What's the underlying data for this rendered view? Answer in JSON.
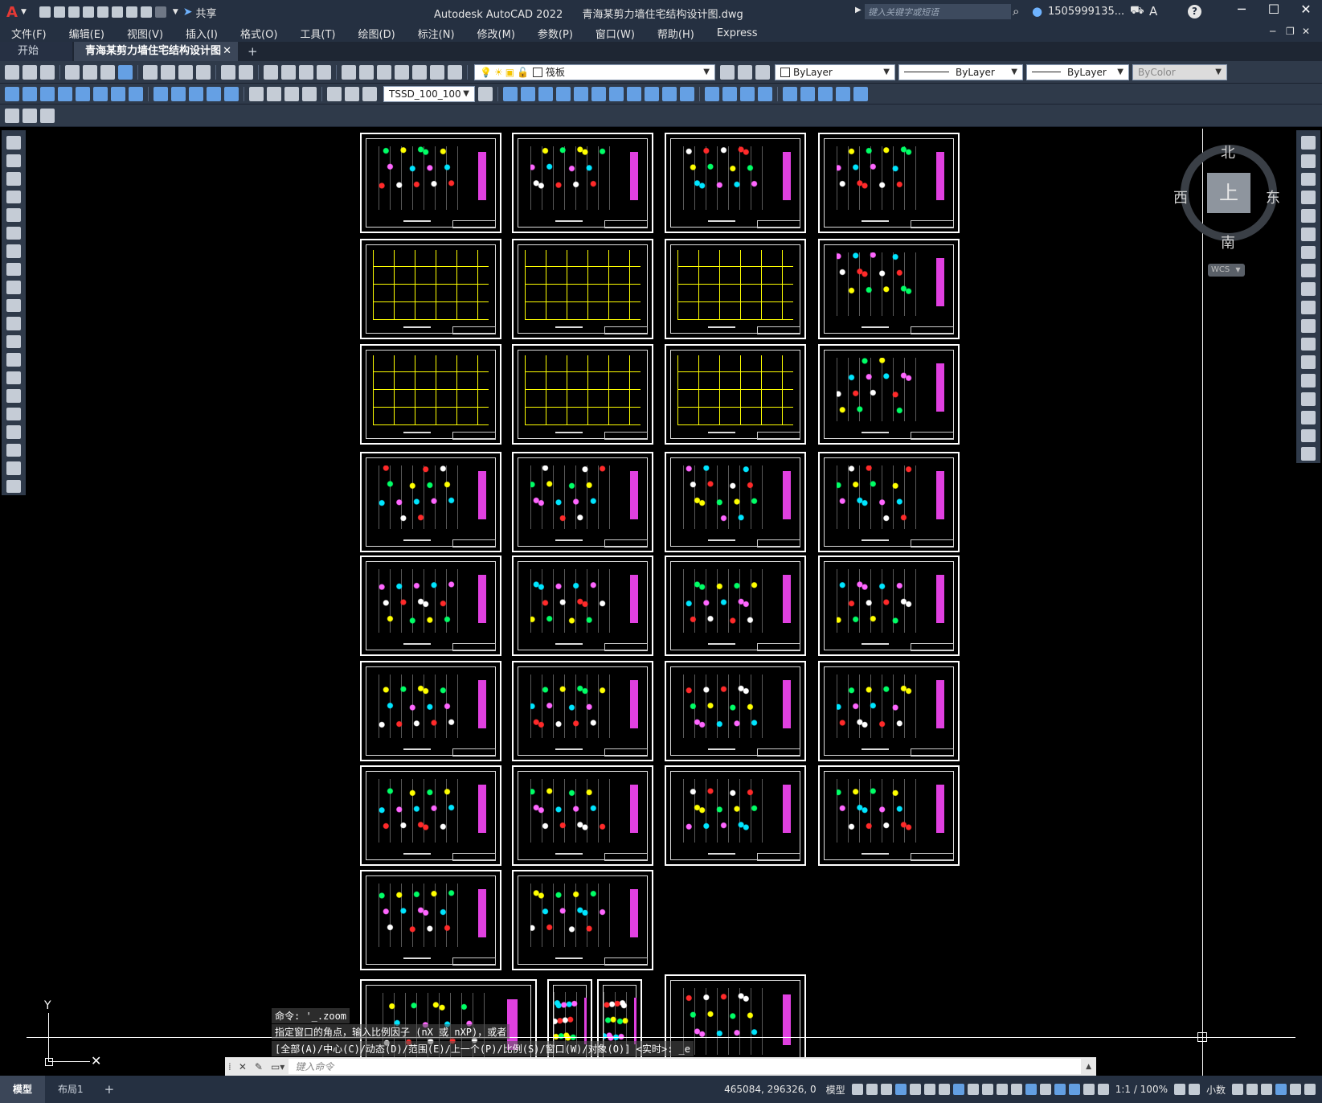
{
  "app": {
    "title": "Autodesk AutoCAD 2022",
    "document": "青海某剪力墙住宅结构设计图.dwg",
    "share_label": "共享",
    "search_placeholder": "键入关键字或短语",
    "user": "1505999135...",
    "help_icon": "?"
  },
  "menu": [
    "文件(F)",
    "编辑(E)",
    "视图(V)",
    "插入(I)",
    "格式(O)",
    "工具(T)",
    "绘图(D)",
    "标注(N)",
    "修改(M)",
    "参数(P)",
    "窗口(W)",
    "帮助(H)",
    "Express"
  ],
  "tabs": [
    {
      "label": "开始",
      "active": false
    },
    {
      "label": "青海某剪力墙住宅结构设计图*",
      "active": true
    }
  ],
  "toolbar": {
    "layer_name": "筏板",
    "color": "ByLayer",
    "linetype": "ByLayer",
    "lineweight": "ByLayer",
    "plotstyle": "ByColor",
    "dimstyle": "TSSD_100_100"
  },
  "viewcube": {
    "north": "北",
    "south": "南",
    "east": "东",
    "west": "西",
    "top": "上",
    "wcs": "WCS"
  },
  "ucs": {
    "y_label": "Y"
  },
  "command": {
    "history": [
      "命令: '_.zoom",
      "指定窗口的角点，输入比例因子 (nX 或 nXP)，或者",
      "[全部(A)/中心(C)/动态(D)/范围(E)/上一个(P)/比例(S)/窗口(W)/对象(O)] <实时>: _e"
    ],
    "input_placeholder": "键入命令"
  },
  "status": {
    "layout_tabs": [
      "模型",
      "布局1"
    ],
    "add_tab": "+",
    "coords": "465084, 296326, 0",
    "space": "模型",
    "scale": "1:1 / 100%",
    "units": "小数"
  },
  "colors": {
    "chrome": "#253041",
    "toolbar": "#2f3a4a",
    "canvas": "#000000",
    "accent_magenta": "#e040e0",
    "accent_yellow": "#ffff00"
  }
}
